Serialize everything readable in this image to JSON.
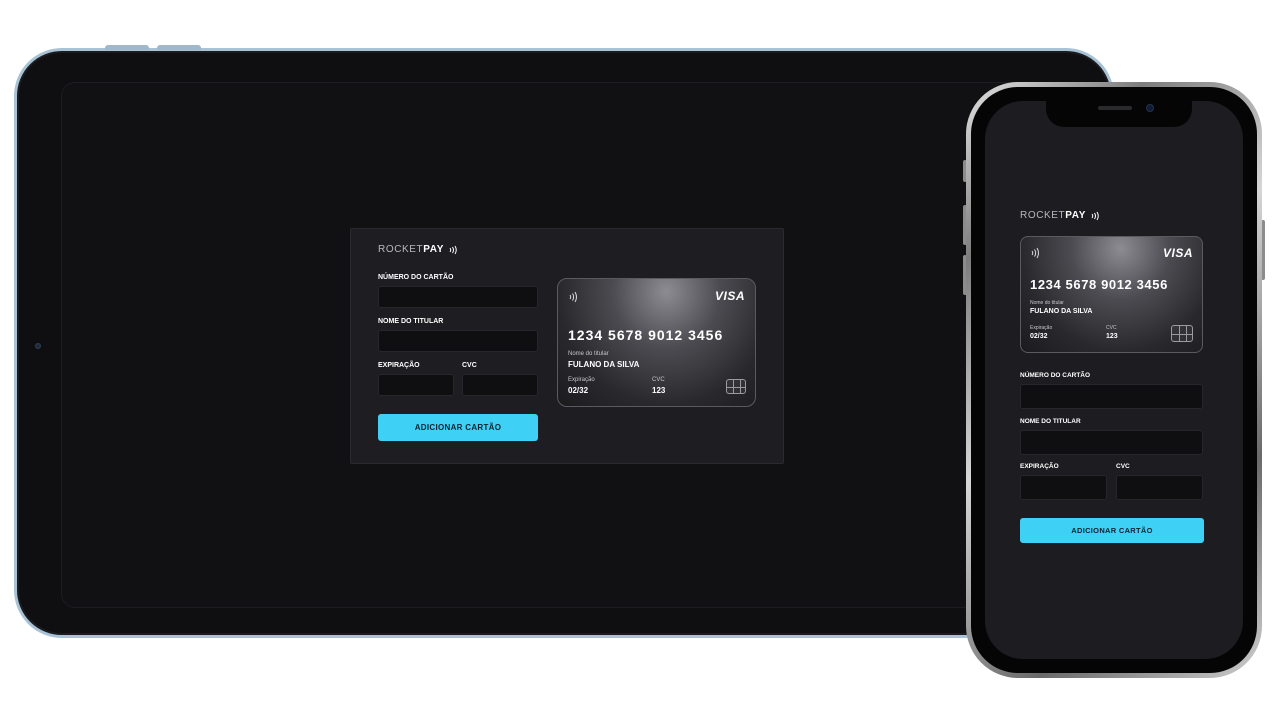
{
  "brand": {
    "light": "ROCKET",
    "bold": "PAY"
  },
  "colors": {
    "accent": "#3fd0f6",
    "background": "#111113",
    "panel": "#1e1e22",
    "input": "#0f0f11"
  },
  "form": {
    "card_number_label": "NÚMERO DO CARTÃO",
    "card_holder_label": "NOME DO TITULAR",
    "expiration_label": "EXPIRAÇÃO",
    "cvc_label": "CVC",
    "submit_label": "ADICIONAR CARTÃO"
  },
  "card": {
    "brand": "VISA",
    "number": "1234 5678 9012 3456",
    "holder_caption": "Nome do titular",
    "holder_name": "FULANO DA SILVA",
    "expiration_caption": "Expiração",
    "expiration_value": "02/32",
    "cvc_caption": "CVC",
    "cvc_value": "123",
    "icons": [
      "contactless-icon",
      "chip-icon"
    ]
  }
}
